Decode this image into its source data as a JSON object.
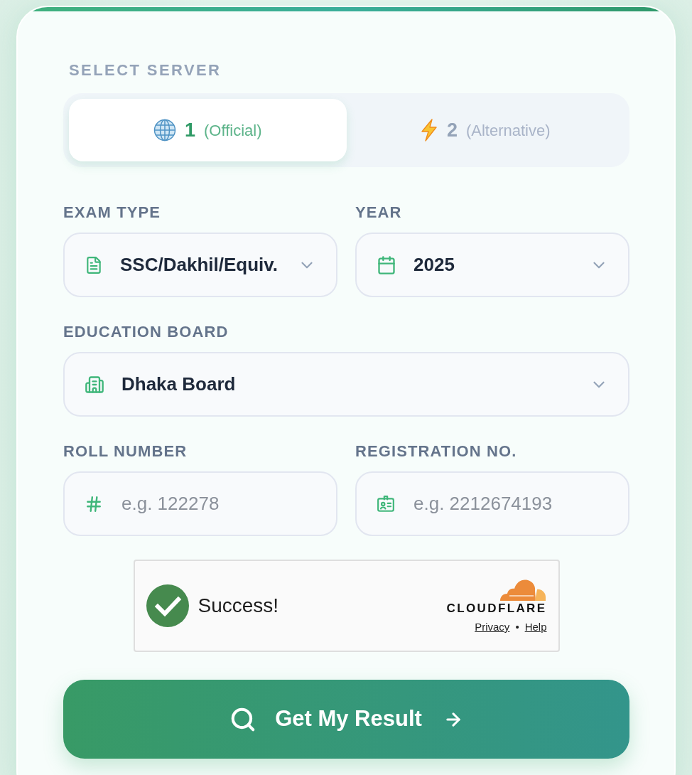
{
  "server_selector": {
    "label": "SELECT SERVER",
    "options": [
      {
        "number": "1",
        "note": "(Official)",
        "selected": true
      },
      {
        "number": "2",
        "note": "(Alternative)",
        "selected": false
      }
    ]
  },
  "form_rows": [
    [
      {
        "kind": "select",
        "label": "EXAM TYPE",
        "value": "SSC/Dakhil/Equiv."
      },
      {
        "kind": "select",
        "label": "YEAR",
        "value": "2025"
      }
    ],
    [
      {
        "kind": "select",
        "label": "EDUCATION BOARD",
        "value": "Dhaka Board"
      }
    ],
    [
      {
        "kind": "input",
        "label": "ROLL NUMBER",
        "placeholder": "e.g. 122278"
      },
      {
        "kind": "input",
        "label": "REGISTRATION NO.",
        "placeholder": "e.g. 2212674193"
      }
    ]
  ],
  "captcha": {
    "status": "Success!",
    "brand": "CLOUDFLARE",
    "links": [
      "Privacy",
      "Help"
    ],
    "separator": "•"
  },
  "submit_button": {
    "label": "Get My Result"
  }
}
